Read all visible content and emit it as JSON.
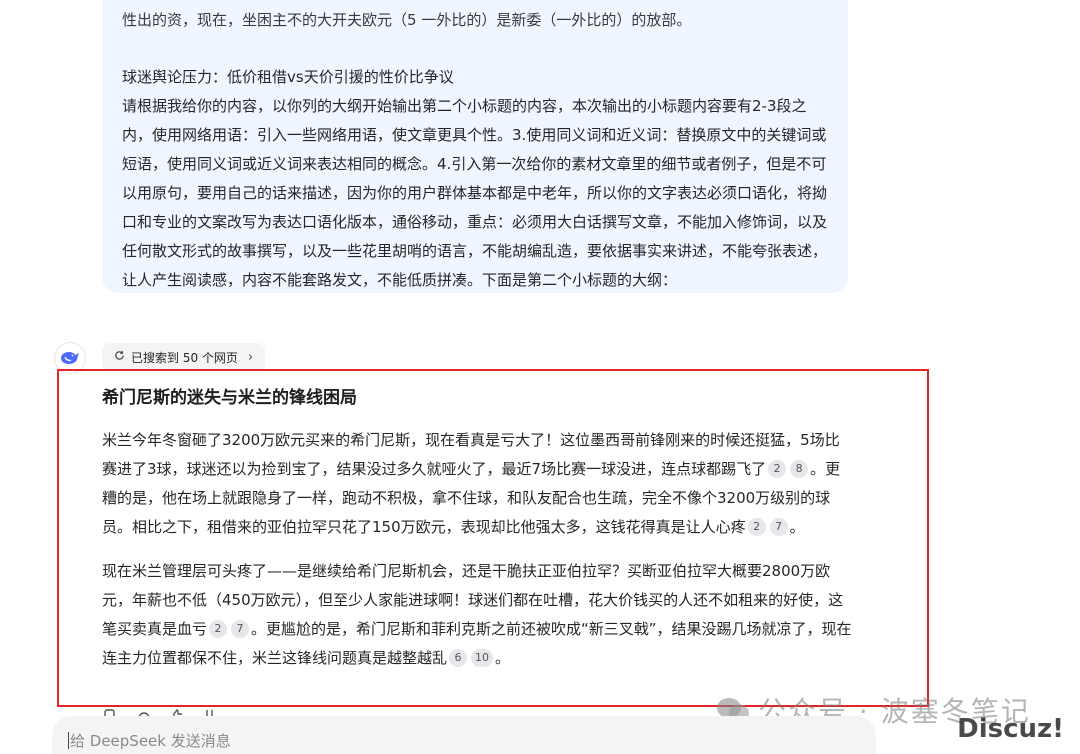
{
  "user_message": {
    "cut_line": "性出的资，现在，坐困主不的大开夫欧元（5 一外比的）是新委（一外比的）的放部。",
    "subtitle": "球迷舆论压力：低价租借vs天价引援的性价比争议",
    "prompt": "请根据我给你的内容，以你列的大纲开始输出第二个小标题的内容，本次输出的小标题内容要有2-3段之内，使用网络用语：引入一些网络用语，使文章更具个性。3.使用同义词和近义词：替换原文中的关键词或短语，使用同义词或近义词来表达相同的概念。4.引入第一次给你的素材文章里的细节或者例子，但是不可以用原句，要用自己的话来描述，因为你的用户群体基本都是中老年，所以你的文字表达必须口语化，将拗口和专业的文案改写为表达口语化版本，通俗移动，重点：必须用大白话撰写文章，不能加入修饰词，以及任何散文形式的故事撰写，以及一些花里胡哨的语言，不能胡编乱造，要依据事实来讲述，不能夸张表述，让人产生阅读感，内容不能套路发文，不能低质拼凑。下面是第二个小标题的大纲："
  },
  "search_pill": {
    "label": "已搜索到 50 个网页",
    "icon": "refresh-icon"
  },
  "answer": {
    "title": "希门尼斯的迷失与米兰的锋线困局",
    "p1": {
      "t1": "米兰今年冬窗砸了3200万欧元买来的希门尼斯，现在看真是亏大了！这位墨西哥前锋刚来的时候还挺猛，5场比赛进了3球，球迷还以为捡到宝了，结果没过多久就哑火了，最近7场比赛一球没进，连点球都踢飞了",
      "c1": "2",
      "c2": "8",
      "t2": "。更糟的是，他在场上就跟隐身了一样，跑动不积极，拿不住球，和队友配合也生疏，完全不像个3200万级别的球员。相比之下，租借来的亚伯拉罕只花了150万欧元，表现却比他强太多，这钱花得真是让人心疼",
      "c3": "2",
      "c4": "7",
      "t3": "。"
    },
    "p2": {
      "t1": "现在米兰管理层可头疼了——是继续给希门尼斯机会，还是干脆扶正亚伯拉罕？买断亚伯拉罕大概要2800万欧元，年薪也不低（450万欧元），但至少人家能进球啊！球迷们都在吐槽，花大价钱买的人还不如租来的好使，这笔买卖真是血亏",
      "c1": "2",
      "c2": "7",
      "t2": "。更尴尬的是，希门尼斯和菲利克斯之前还被吹成“新三叉戟”，结果没踢几场就凉了，现在连主力位置都保不住，米兰这锋线问题真是越整越乱",
      "c3": "6",
      "c4": "10",
      "t3": "。"
    }
  },
  "input": {
    "placeholder": "给 DeepSeek 发送消息"
  },
  "watermarks": {
    "wechat": "公众号 · 波塞冬笔记",
    "site": "Discuz!"
  },
  "colors": {
    "highlight_border": "#e0262b",
    "user_bubble": "#eff6ff",
    "brand_blue": "#4d6bfe"
  }
}
